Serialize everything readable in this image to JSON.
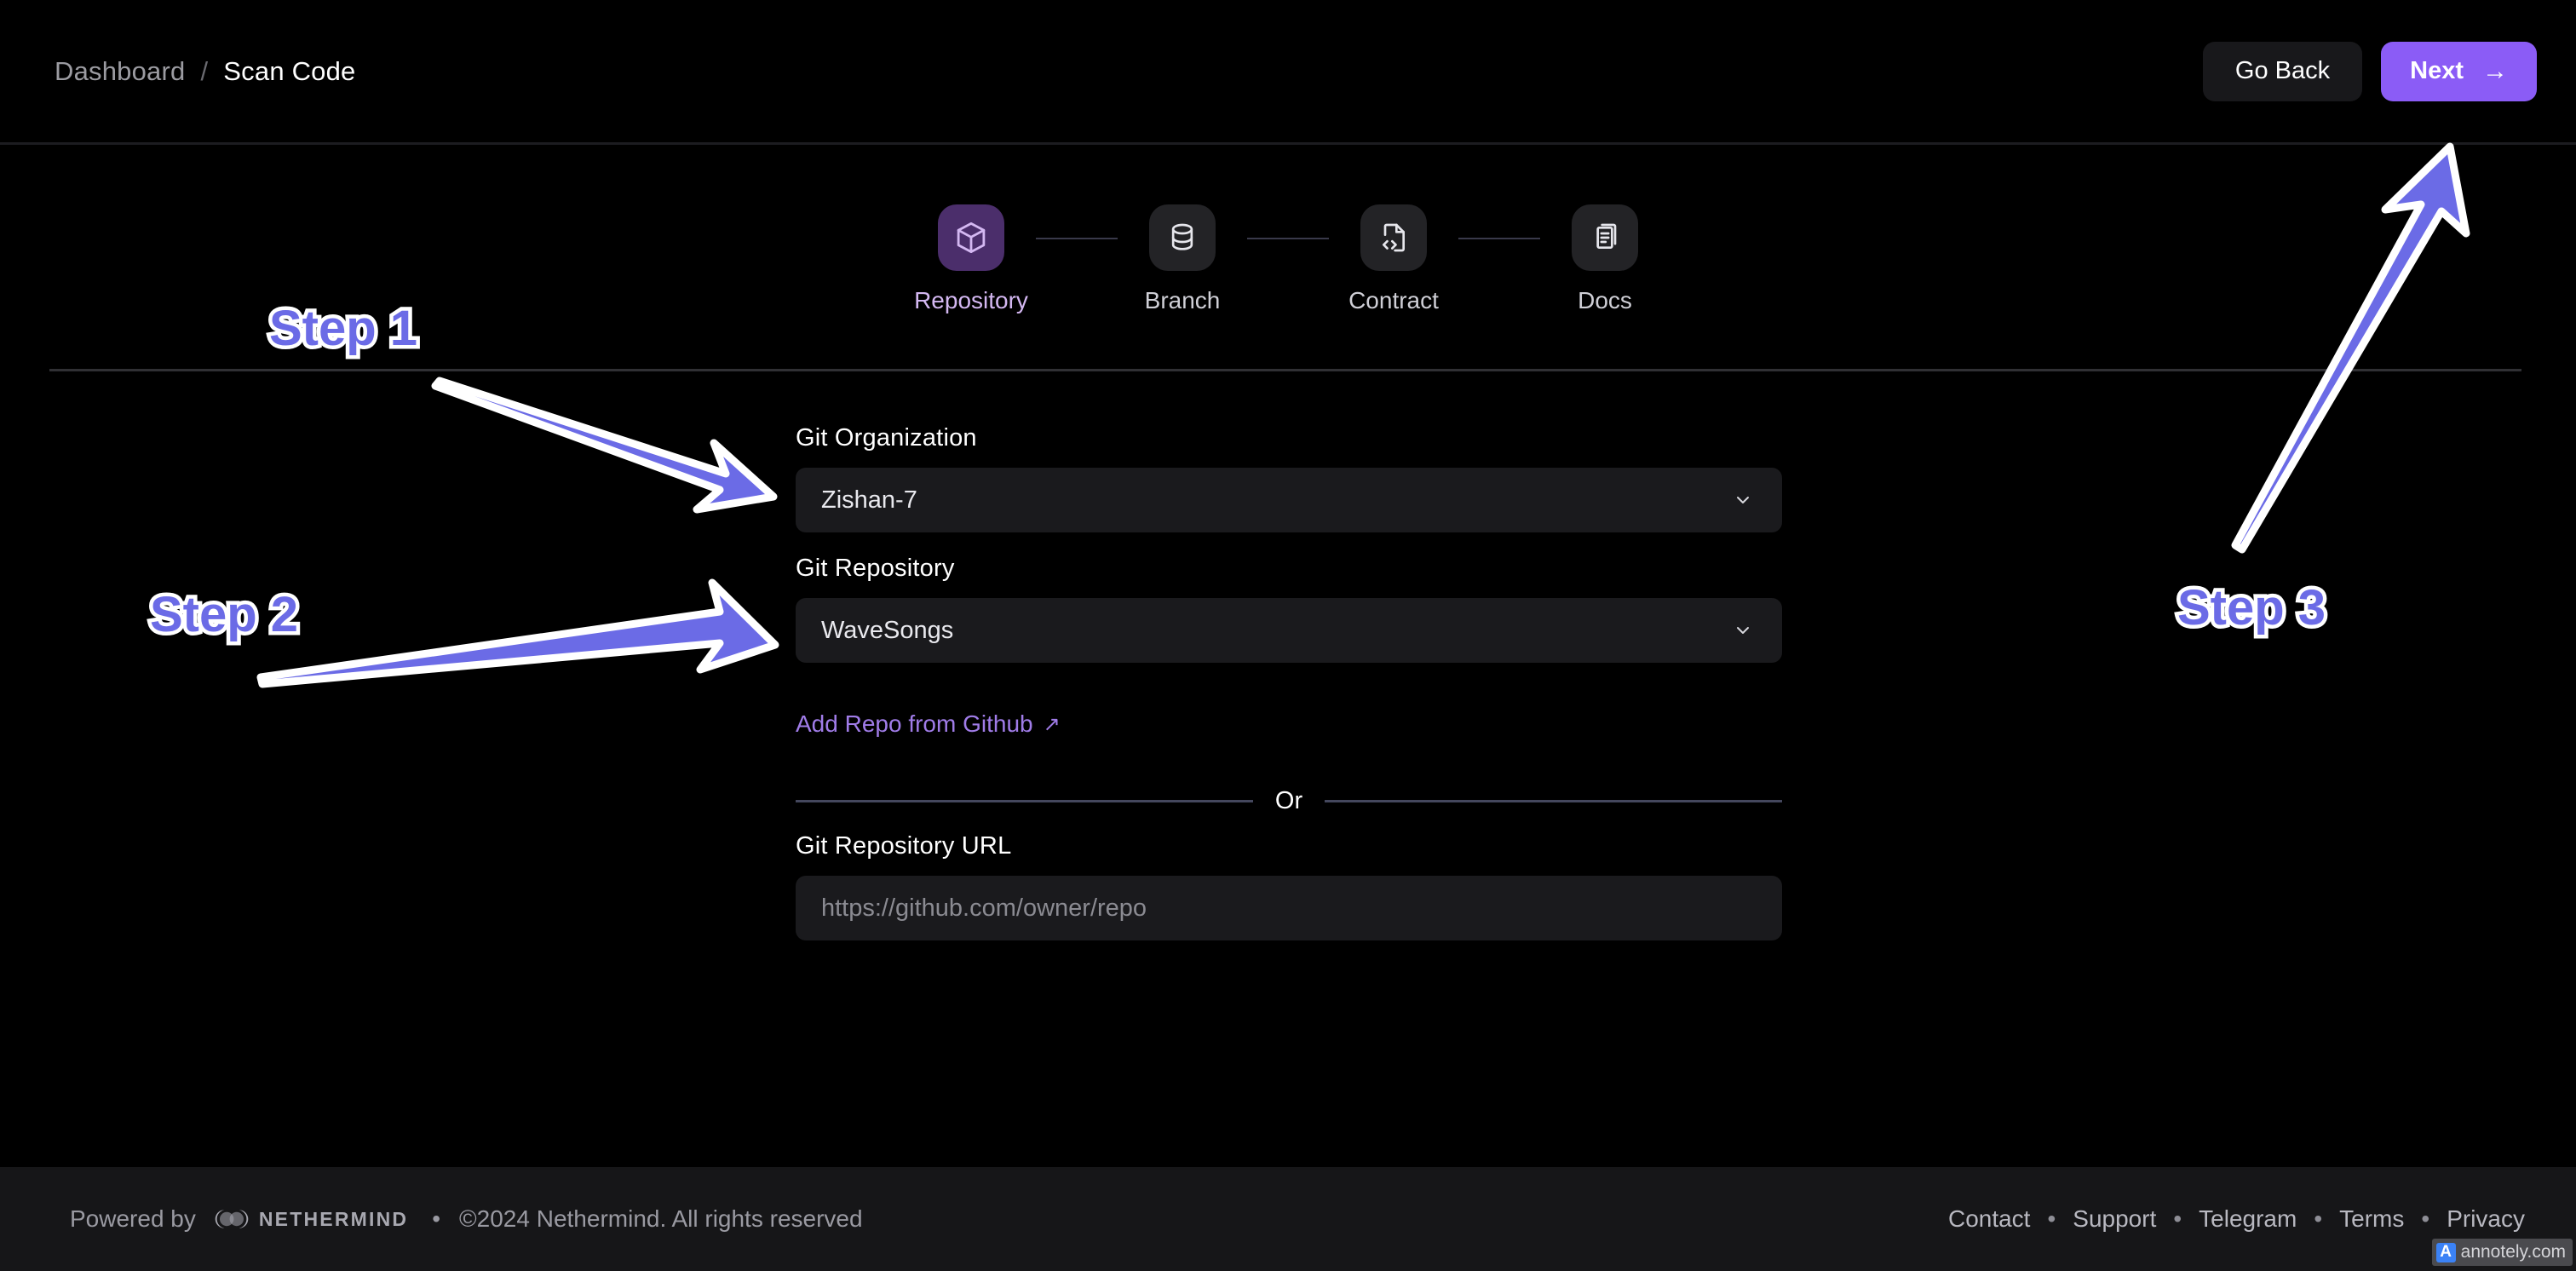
{
  "header": {
    "breadcrumb": {
      "root": "Dashboard",
      "separator": "/",
      "current": "Scan Code"
    },
    "go_back_label": "Go Back",
    "next_label": "Next",
    "next_arrow": "→"
  },
  "stepper": {
    "steps": [
      {
        "label": "Repository",
        "icon": "cube-icon",
        "active": true
      },
      {
        "label": "Branch",
        "icon": "database-icon",
        "active": false
      },
      {
        "label": "Contract",
        "icon": "file-code-icon",
        "active": false
      },
      {
        "label": "Docs",
        "icon": "documents-icon",
        "active": false
      }
    ]
  },
  "form": {
    "git_organization": {
      "label": "Git Organization",
      "value": "Zishan-7"
    },
    "git_repository": {
      "label": "Git Repository",
      "value": "WaveSongs"
    },
    "add_repo_link": {
      "label": "Add Repo from Github",
      "icon": "external-link-icon",
      "glyph": "↗"
    },
    "or_text": "Or",
    "git_repository_url": {
      "label": "Git Repository URL",
      "value": "",
      "placeholder": "https://github.com/owner/repo"
    }
  },
  "footer": {
    "powered_by": "Powered by",
    "brand": "NETHERMIND",
    "separator": "•",
    "copyright": "©2024 Nethermind. All rights reserved",
    "links": [
      "Contact",
      "Support",
      "Telegram",
      "Terms",
      "Privacy"
    ]
  },
  "annotations": {
    "step1": "Step 1",
    "step2": "Step 2",
    "step3": "Step 3",
    "accent_color": "#6b6be6",
    "outline_color": "#ffffff"
  },
  "watermark": {
    "badge": "A",
    "text": "annotely.com"
  },
  "colors": {
    "page_background": "#000000",
    "footer_background": "#161618",
    "field_background": "#1a1a1d",
    "accent_purple": "#8b5cf6",
    "step_active_background": "#4b2e6b",
    "step_inactive_background": "#232326",
    "link_purple": "#a07ce8"
  }
}
